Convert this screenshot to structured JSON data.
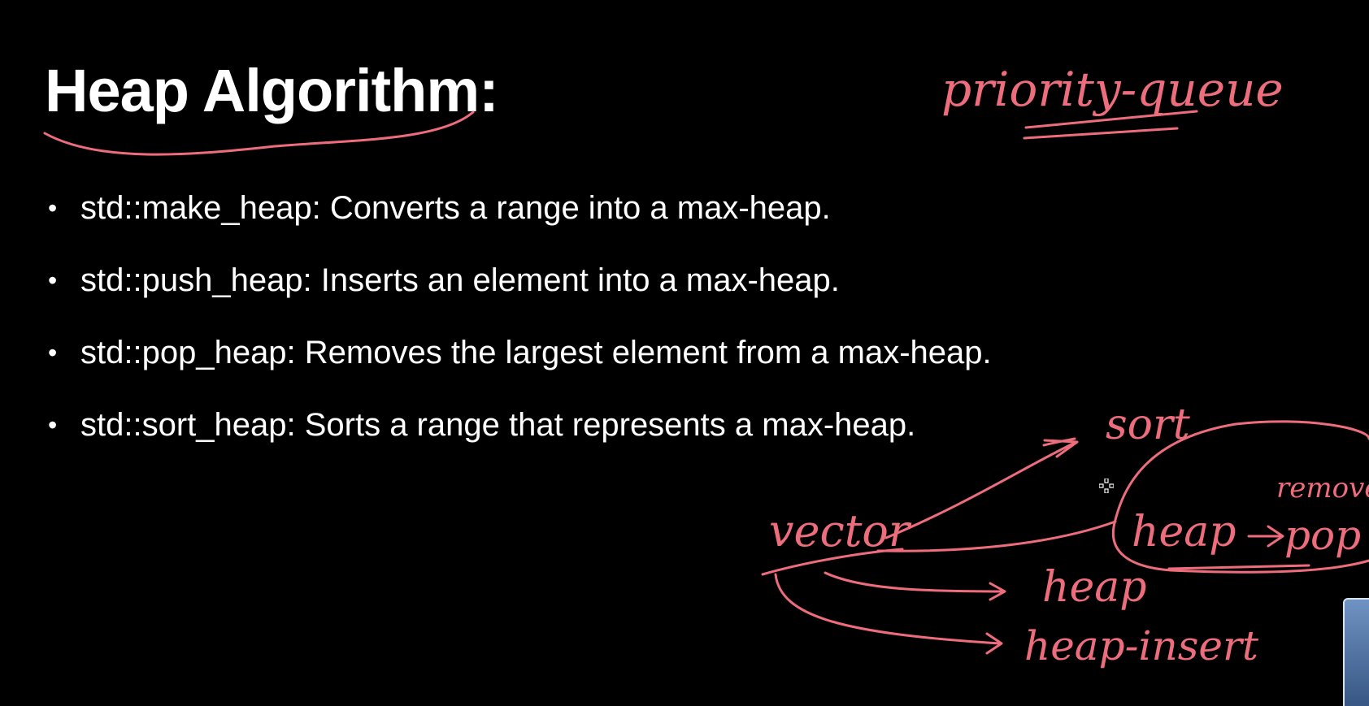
{
  "slide": {
    "title": "Heap Algorithm:",
    "bullets": [
      {
        "text": "std::make_heap: Converts a range into a max-heap."
      },
      {
        "text": "std::push_heap: Inserts an element into a max-heap."
      },
      {
        "text": "std::pop_heap: Removes the largest element from a max-heap."
      },
      {
        "text": "std::sort_heap: Sorts a range that represents a max-heap."
      }
    ]
  },
  "annotations": {
    "priority_queue": "priority-queue",
    "sort": "sort",
    "vector": "vector",
    "heap_in_loop": "heap",
    "pop": "pop",
    "remove": "remove",
    "heap": "heap",
    "heap_insert": "heap-insert"
  },
  "colors": {
    "background": "#000000",
    "text": "#ffffff",
    "ink": "#ee6d7c"
  },
  "icons": {
    "cursor": "crosshair-cursor-icon",
    "bullet": "bullet-dot-icon"
  }
}
